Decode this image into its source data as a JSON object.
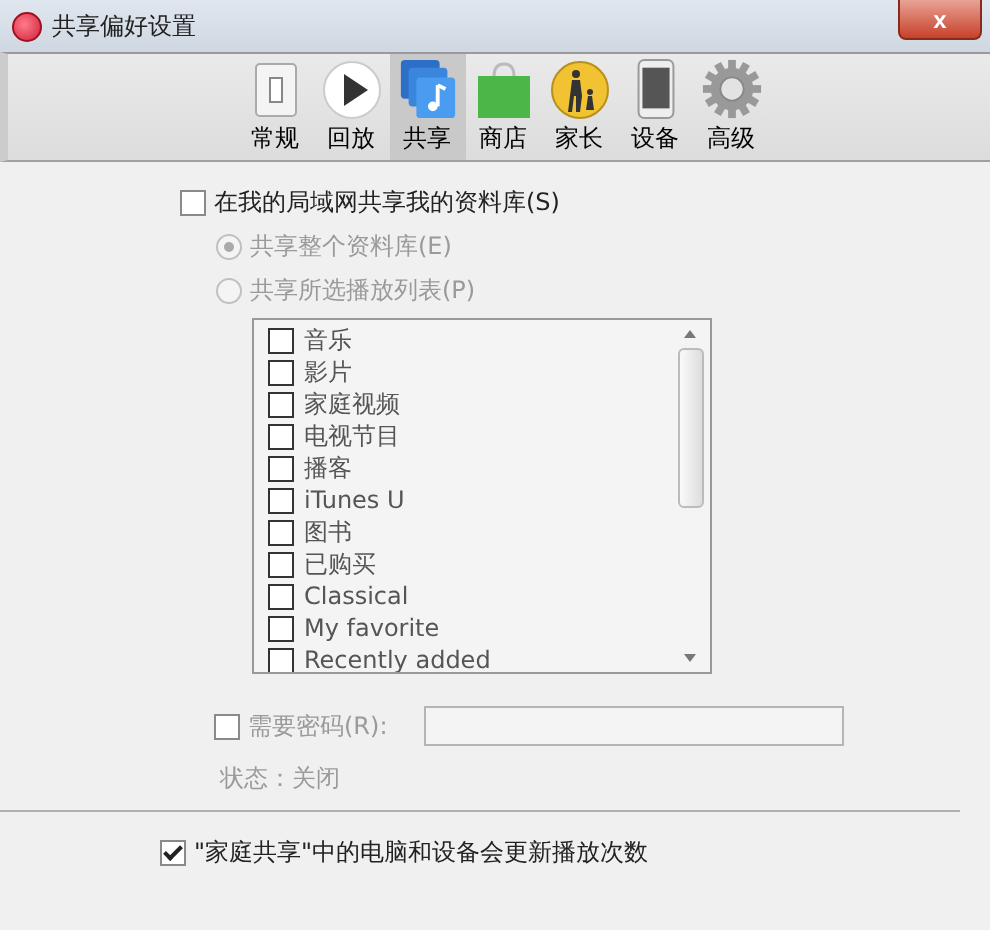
{
  "window": {
    "title": "共享偏好设置",
    "close": "x"
  },
  "tabs": [
    {
      "label": "常规",
      "kind": "general",
      "selected": false
    },
    {
      "label": "回放",
      "kind": "playback",
      "selected": false
    },
    {
      "label": "共享",
      "kind": "sharing",
      "selected": true
    },
    {
      "label": "商店",
      "kind": "store",
      "selected": false
    },
    {
      "label": "家长",
      "kind": "parental",
      "selected": false
    },
    {
      "label": "设备",
      "kind": "devices",
      "selected": false
    },
    {
      "label": "高级",
      "kind": "advanced",
      "selected": false
    }
  ],
  "share_library": {
    "label": "在我的局域网共享我的资料库(S)",
    "checked": false
  },
  "share_options": [
    {
      "label": "共享整个资料库(E)",
      "selected": true
    },
    {
      "label": "共享所选播放列表(P)",
      "selected": false
    }
  ],
  "playlists": [
    {
      "label": "音乐",
      "checked": false
    },
    {
      "label": "影片",
      "checked": false
    },
    {
      "label": "家庭视频",
      "checked": false
    },
    {
      "label": "电视节目",
      "checked": false
    },
    {
      "label": "播客",
      "checked": false
    },
    {
      "label": "iTunes U",
      "checked": false
    },
    {
      "label": "图书",
      "checked": false
    },
    {
      "label": "已购买",
      "checked": false
    },
    {
      "label": "Classical",
      "checked": false
    },
    {
      "label": "My favorite",
      "checked": false
    },
    {
      "label": "Recently added",
      "checked": false
    }
  ],
  "password": {
    "label": "需要密码(R):",
    "checked": false
  },
  "status": "状态：关闭",
  "home_sharing": {
    "label": "\"家庭共享\"中的电脑和设备会更新播放次数",
    "checked": true
  }
}
